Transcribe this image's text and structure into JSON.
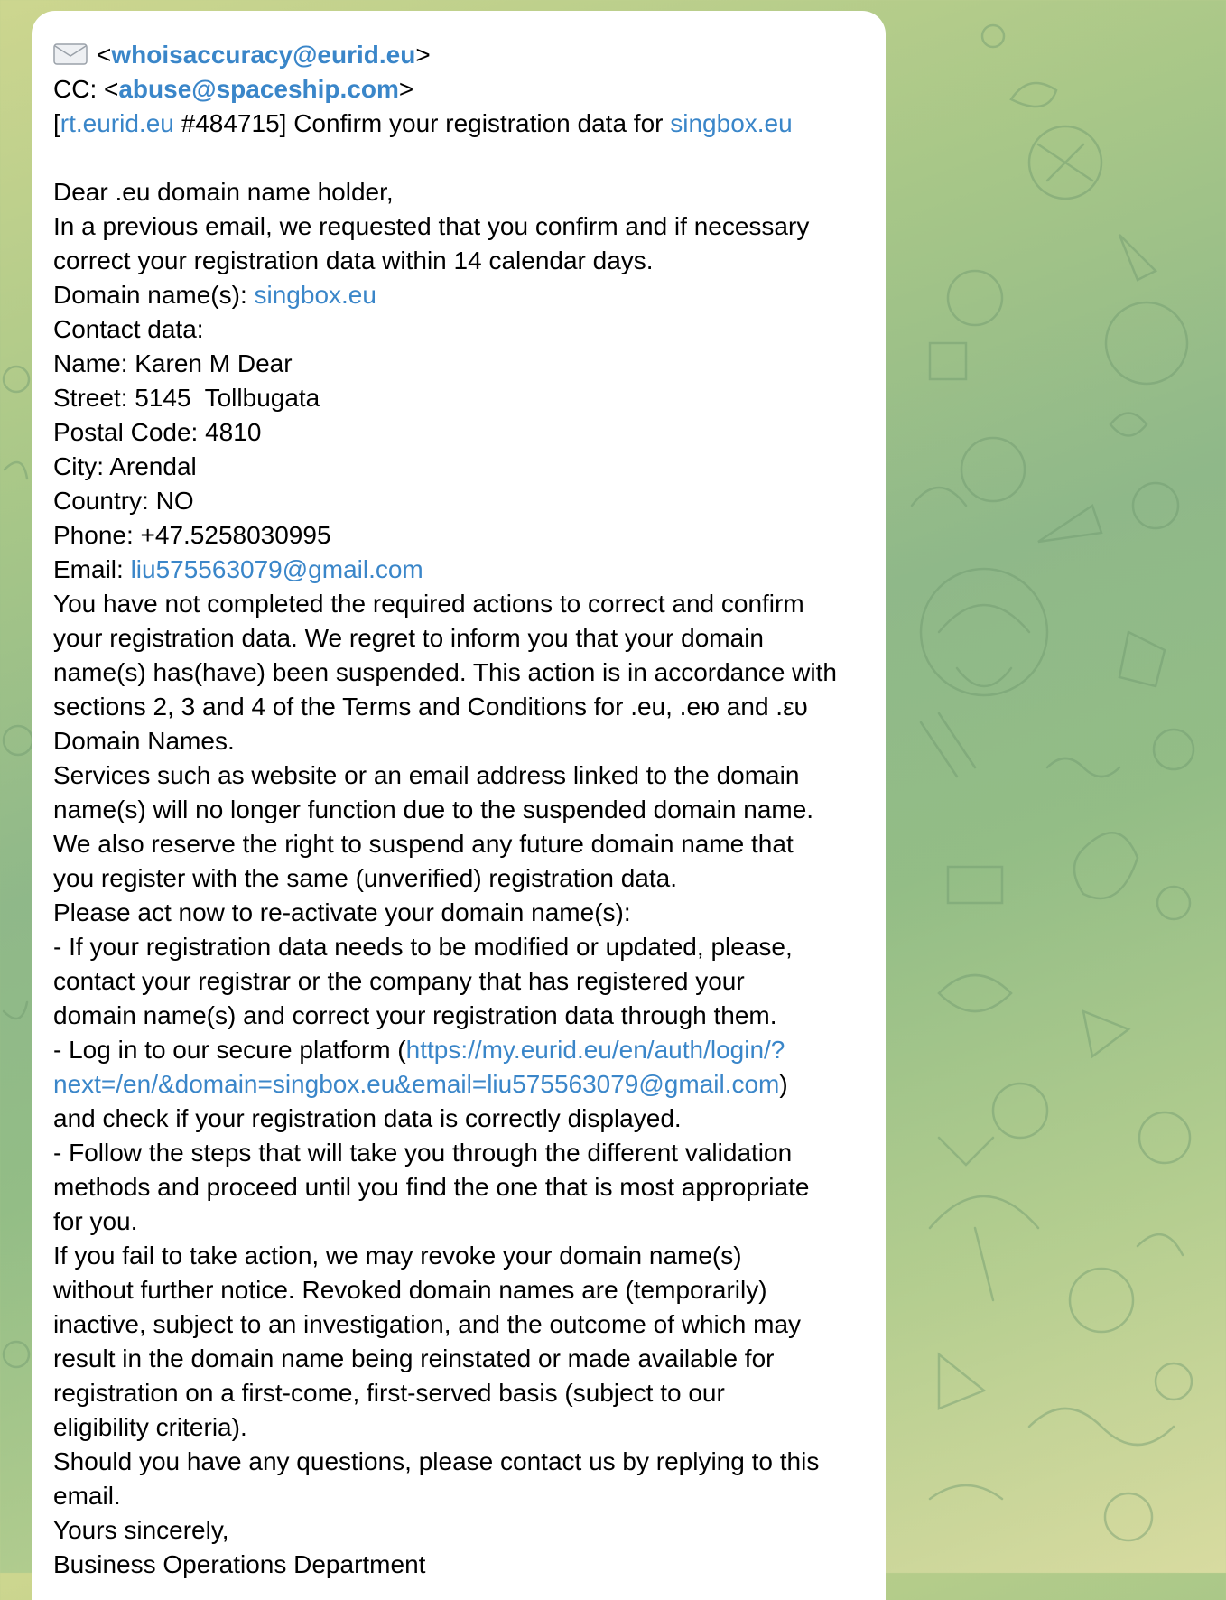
{
  "header": {
    "envelope_icon": "envelope-icon",
    "from_open": "<",
    "from_email": "whoisaccuracy@eurid.eu",
    "from_close": ">",
    "cc_prefix": "CC: <",
    "cc_email": "abuse@spaceship.com",
    "cc_close": ">",
    "subject_open": "[",
    "subject_link": "rt.eurid.eu",
    "subject_text": " #484715] Confirm your registration data for ",
    "subject_domain": "singbox.eu"
  },
  "body": {
    "greeting": "Dear .eu domain name holder,",
    "p1_l1": "In a previous email, we requested that you confirm and if necessary",
    "p1_l2": "correct your registration data within 14 calendar days.",
    "domain_label": "Domain name(s): ",
    "domain_value": "singbox.eu",
    "contact_label": "Contact data:",
    "name": "Name: Karen M Dear",
    "street": "Street: 5145  Tollbugata",
    "postal": "Postal Code: 4810",
    "city": "City: Arendal",
    "country": "Country: NO",
    "phone": "Phone: +47.5258030995",
    "email_label": "Email: ",
    "email_value": "liu575563079@gmail.com",
    "p2_l1": "You have not completed the required actions to correct and confirm",
    "p2_l2": "your registration data. We regret to inform you that your domain",
    "p2_l3": "name(s) has(have) been suspended. This action is in accordance with",
    "p2_l4": "sections 2, 3 and 4 of the Terms and Conditions for .eu, .ею and .ευ",
    "p2_l5": "Domain Names.",
    "p3_l1": "Services such as website or an email address linked to the domain",
    "p3_l2": "name(s) will no longer function due to the suspended domain name.",
    "p3_l3": "We also reserve the right to suspend any future domain name that",
    "p3_l4": "you register with the same (unverified) registration data.",
    "p4_l1": "Please act now to re-activate your domain name(s):",
    "p5_l1": "- If your registration data needs to be modified or updated, please,",
    "p5_l2": "contact your registrar or the company that has registered your",
    "p5_l3": "domain name(s) and correct your registration data through them.",
    "p6_pre": "- Log in to our secure platform (",
    "p6_link1": "https://my.eurid.eu/en/auth/login/?",
    "p6_link2": "next=/en/&domain=singbox.eu&email=liu575563079@gmail.com",
    "p6_post": ")",
    "p6_l3": "and check if your registration data is correctly displayed.",
    "p7_l1": "- Follow the steps that will take you through the different validation",
    "p7_l2": "methods and proceed until you find the one that is most appropriate",
    "p7_l3": "for you.",
    "p8_l1": "If you fail to take action, we may revoke your domain name(s)",
    "p8_l2": "without further notice. Revoked domain names are (temporarily)",
    "p8_l3": "inactive, subject to an investigation, and the outcome of which may",
    "p8_l4": "result in the domain name being reinstated or made available for",
    "p8_l5": "registration on a first-come, first-served basis (subject to our",
    "p8_l6": "eligibility criteria).",
    "p9_l1": "Should you have any questions, please contact us by replying to this",
    "p9_l2": "email.",
    "closing": "Yours sincerely,",
    "signature": "Business Operations Department"
  },
  "colors": {
    "link": "#3a86c9",
    "bubble": "#ffffff"
  }
}
